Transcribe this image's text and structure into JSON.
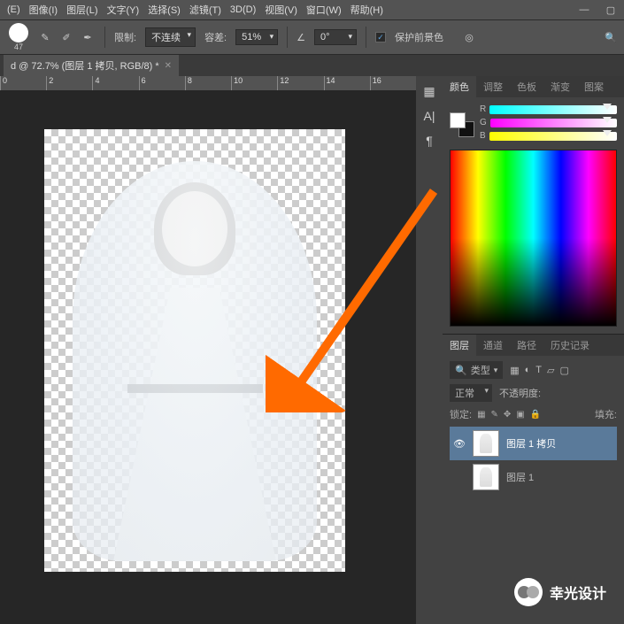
{
  "menu": {
    "items": [
      "(E)",
      "图像(I)",
      "图层(L)",
      "文字(Y)",
      "选择(S)",
      "滤镜(T)",
      "3D(D)",
      "视图(V)",
      "窗口(W)",
      "帮助(H)"
    ]
  },
  "options": {
    "brush_size": "47",
    "limit_label": "限制:",
    "limit_value": "不连续",
    "tolerance_label": "容差:",
    "tolerance_value": "51%",
    "angle_icon": "∠",
    "angle_value": "0°",
    "protect_fg": "保护前景色"
  },
  "doc_tab": {
    "title": "d @ 72.7% (图层 1 拷贝, RGB/8) *"
  },
  "ruler_marks": [
    "0",
    "2",
    "4",
    "6",
    "8",
    "10",
    "12",
    "14",
    "16"
  ],
  "panel_tabs": {
    "color": "颜色",
    "adjust": "调整",
    "swatch": "色板",
    "gradient": "渐变",
    "pattern": "图案"
  },
  "rgb": {
    "r": "R",
    "g": "G",
    "b": "B"
  },
  "layers_panel": {
    "tabs": {
      "layers": "图层",
      "channels": "通道",
      "paths": "路径",
      "history": "历史记录"
    },
    "kind_prefix": "🔍",
    "kind": "类型",
    "blend": "正常",
    "opacity_label": "不透明度:",
    "lock_label": "锁定:",
    "fill_label": "填充:",
    "layers": [
      {
        "name": "图层 1 拷贝",
        "visible": true,
        "selected": true
      },
      {
        "name": "图层 1",
        "visible": false,
        "selected": false
      }
    ]
  },
  "watermark": "幸光设计"
}
